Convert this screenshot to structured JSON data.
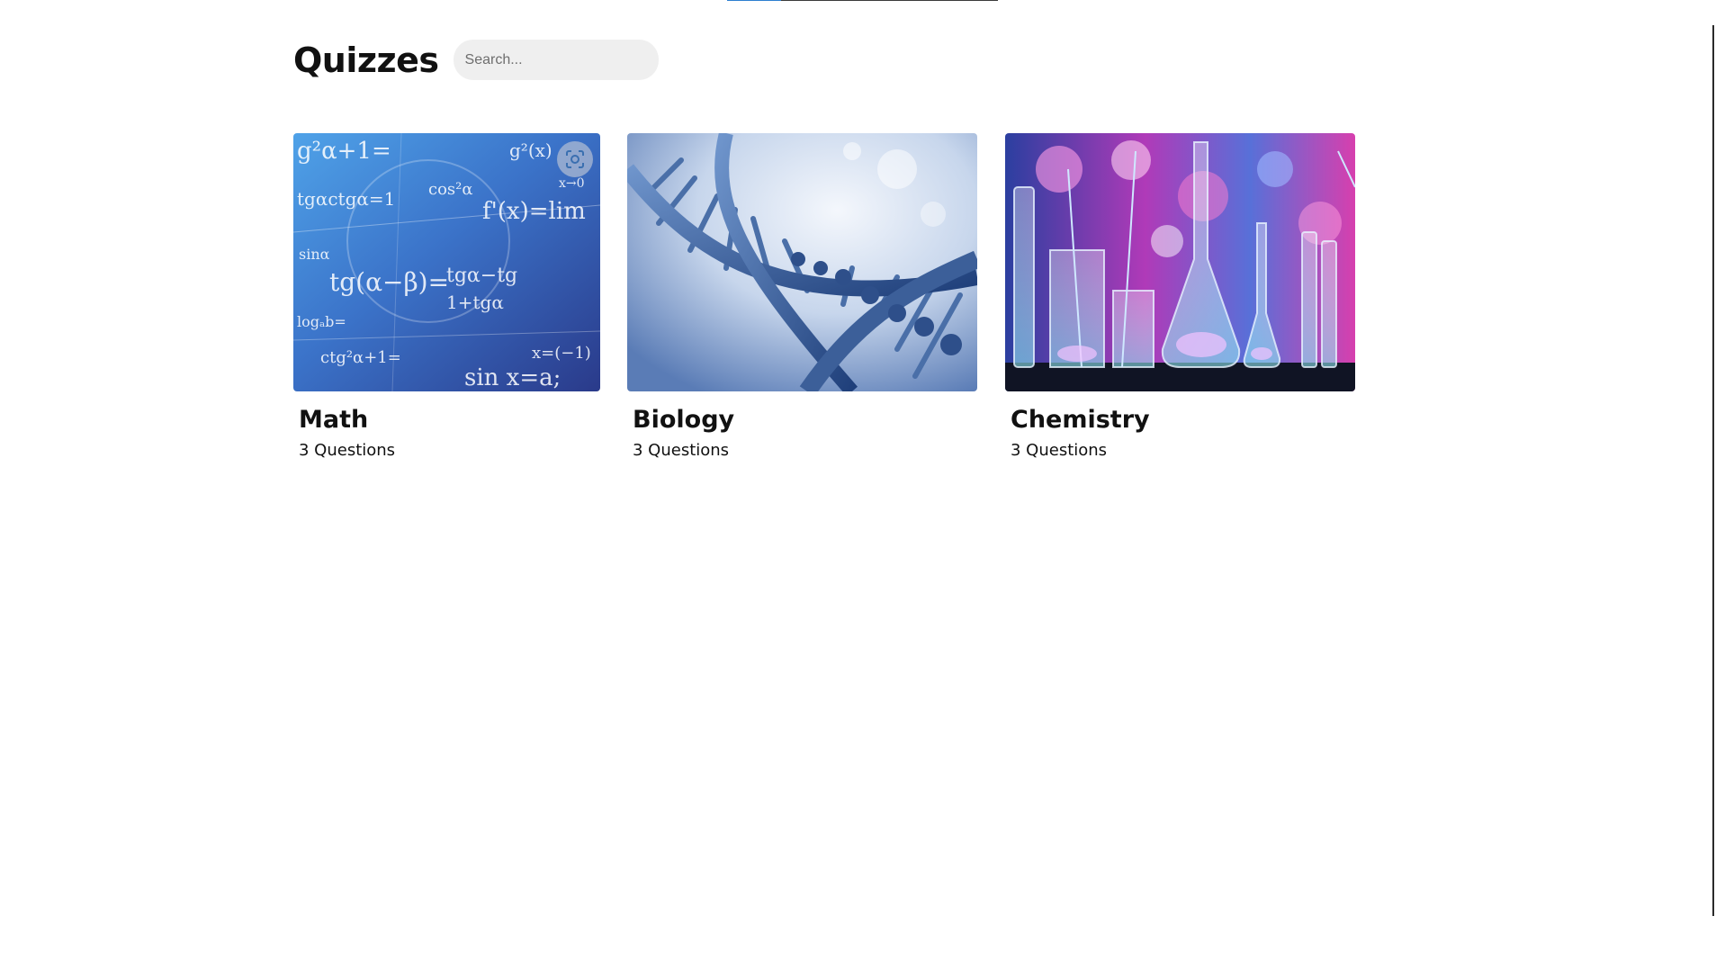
{
  "page": {
    "title": "Quizzes"
  },
  "search": {
    "placeholder": "Search..."
  },
  "loading_progress": 0.2,
  "quizzes": [
    {
      "title": "Math",
      "count": "3 Questions",
      "image": "math-formulas-image"
    },
    {
      "title": "Biology",
      "count": "3 Questions",
      "image": "dna-helix-image"
    },
    {
      "title": "Chemistry",
      "count": "3 Questions",
      "image": "lab-glassware-image"
    }
  ],
  "icons": {
    "visual_search": "lens-scan-icon"
  },
  "colors": {
    "progress_fill": "#2d7fd0",
    "search_background": "#efefef",
    "math_tint": "#2f5fb5",
    "biology_tint": "#4f79b8",
    "chemistry_tint": "#c23bb6"
  }
}
